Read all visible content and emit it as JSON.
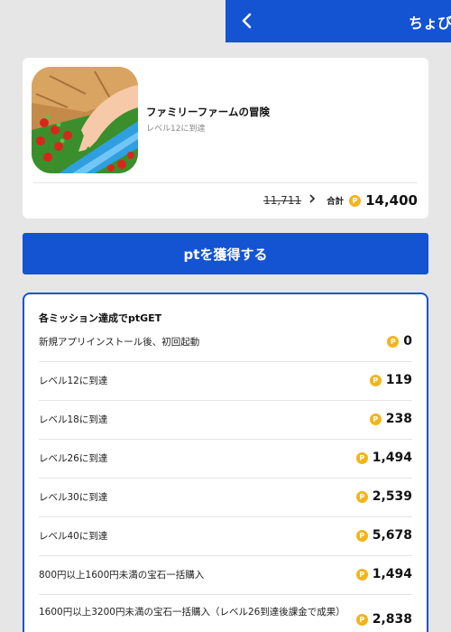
{
  "header": {
    "back_label": "‹",
    "title": "ちょび"
  },
  "app": {
    "name": "ファミリーファームの冒険",
    "subtitle": "レベル12に到達",
    "old_price": "11,711",
    "total_label": "合計",
    "total_value": "14,400"
  },
  "cta_label": "ptを獲得する",
  "missions": {
    "title": "各ミッション達成でptGET",
    "items": [
      {
        "label": "新規アプリインストール後、初回起動",
        "value": "0"
      },
      {
        "label": "レベル12に到達",
        "value": "119"
      },
      {
        "label": "レベル18に到達",
        "value": "238"
      },
      {
        "label": "レベル26に到達",
        "value": "1,494"
      },
      {
        "label": "レベル30に到達",
        "value": "2,539"
      },
      {
        "label": "レベル40に到達",
        "value": "5,678"
      },
      {
        "label": "800円以上1600円未満の宝石一括購入",
        "value": "1,494"
      },
      {
        "label": "1600円以上3200円未満の宝石一括購入（レベル26到達後課金で成果）",
        "value": "2,838"
      }
    ]
  },
  "coin_symbol": "P",
  "colors": {
    "accent": "#1453d2",
    "coin": "#f2b51c",
    "background": "#e6e6e6"
  }
}
